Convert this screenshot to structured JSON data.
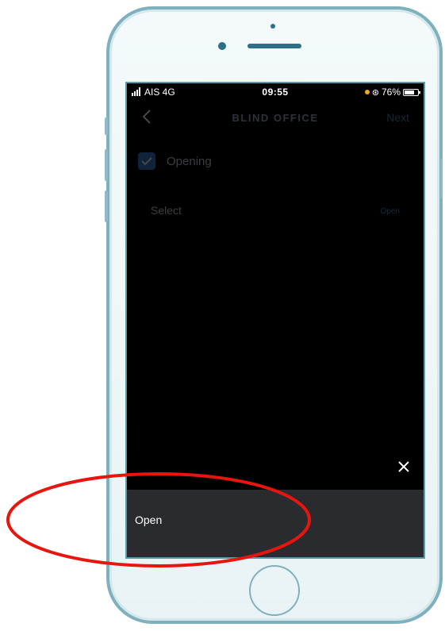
{
  "status_bar": {
    "carrier": "AIS  4G",
    "time": "09:55",
    "battery_percent": "76%",
    "battery_level": 0.76
  },
  "nav": {
    "title": "BLIND OFFICE",
    "next_label": "Next",
    "back_icon": "chevron-left-icon"
  },
  "form": {
    "opening_label": "Opening",
    "opening_checked": true,
    "select_label": "Select",
    "select_value": "Open"
  },
  "sheet": {
    "close_icon": "close-icon",
    "options": [
      "Open"
    ]
  },
  "colors": {
    "accent": "#3b7ecf",
    "annotation": "#e8150f",
    "phone_frame": "#7fb0bd",
    "screen_background": "#000000",
    "sheet_background": "#2a2b2e"
  }
}
